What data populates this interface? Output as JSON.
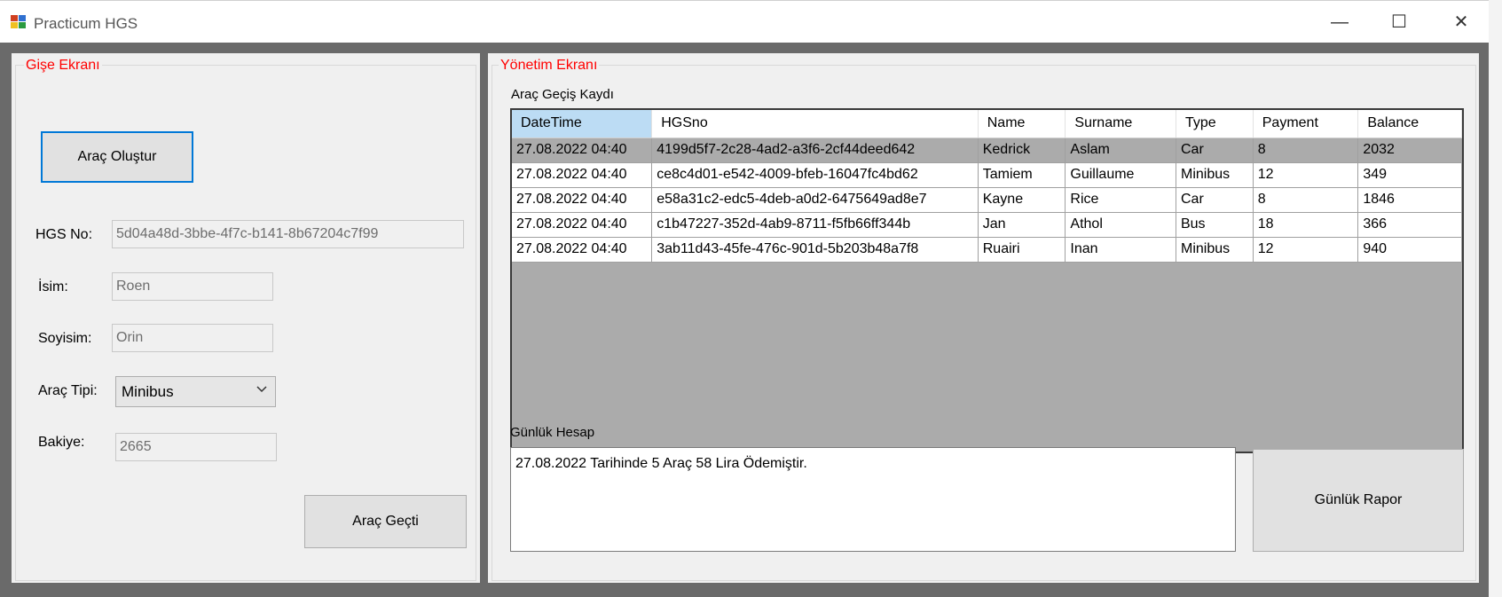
{
  "window": {
    "title": "Practicum HGS"
  },
  "gise": {
    "legend": "Gişe Ekranı",
    "create_button": "Araç Oluştur",
    "hgs_label": "HGS No:",
    "hgs_value": "5d04a48d-3bbe-4f7c-b141-8b67204c7f99",
    "name_label": "İsim:",
    "name_value": "Roen",
    "surname_label": "Soyisim:",
    "surname_value": "Orin",
    "type_label": "Araç Tipi:",
    "type_value": "Minibus",
    "balance_label": "Bakiye:",
    "balance_value": "2665",
    "pass_button": "Araç Geçti"
  },
  "yonetim": {
    "legend": "Yönetim Ekranı",
    "grid_label": "Araç Geçiş Kaydı",
    "columns": [
      "DateTime",
      "HGSno",
      "Name",
      "Surname",
      "Type",
      "Payment",
      "Balance"
    ],
    "rows": [
      [
        "27.08.2022 04:40",
        "4199d5f7-2c28-4ad2-a3f6-2cf44deed642",
        "Kedrick",
        "Aslam",
        "Car",
        "8",
        "2032"
      ],
      [
        "27.08.2022 04:40",
        "ce8c4d01-e542-4009-bfeb-16047fc4bd62",
        "Tamiem",
        "Guillaume",
        "Minibus",
        "12",
        "349"
      ],
      [
        "27.08.2022 04:40",
        "e58a31c2-edc5-4deb-a0d2-6475649ad8e7",
        "Kayne",
        "Rice",
        "Car",
        "8",
        "1846"
      ],
      [
        "27.08.2022 04:40",
        "c1b47227-352d-4ab9-8711-f5fb66ff344b",
        "Jan",
        "Athol",
        "Bus",
        "18",
        "366"
      ],
      [
        "27.08.2022 04:40",
        "3ab11d43-45fe-476c-901d-5b203b48a7f8",
        "Ruairi",
        "Inan",
        "Minibus",
        "12",
        "940"
      ]
    ],
    "daily_label": "Günlük Hesap",
    "daily_text": "27.08.2022 Tarihinde 5 Araç 58 Lira Ödemiştir.",
    "report_button": "Günlük Rapor"
  },
  "colors": {
    "legend": "#ff0000",
    "accent": "#0078d7",
    "frame": "#6a6a6a"
  },
  "icons": {
    "app": "app-icon",
    "minimize": "minimize-icon",
    "maximize": "maximize-icon",
    "close": "close-icon",
    "dropdown": "chevron-down-icon"
  }
}
